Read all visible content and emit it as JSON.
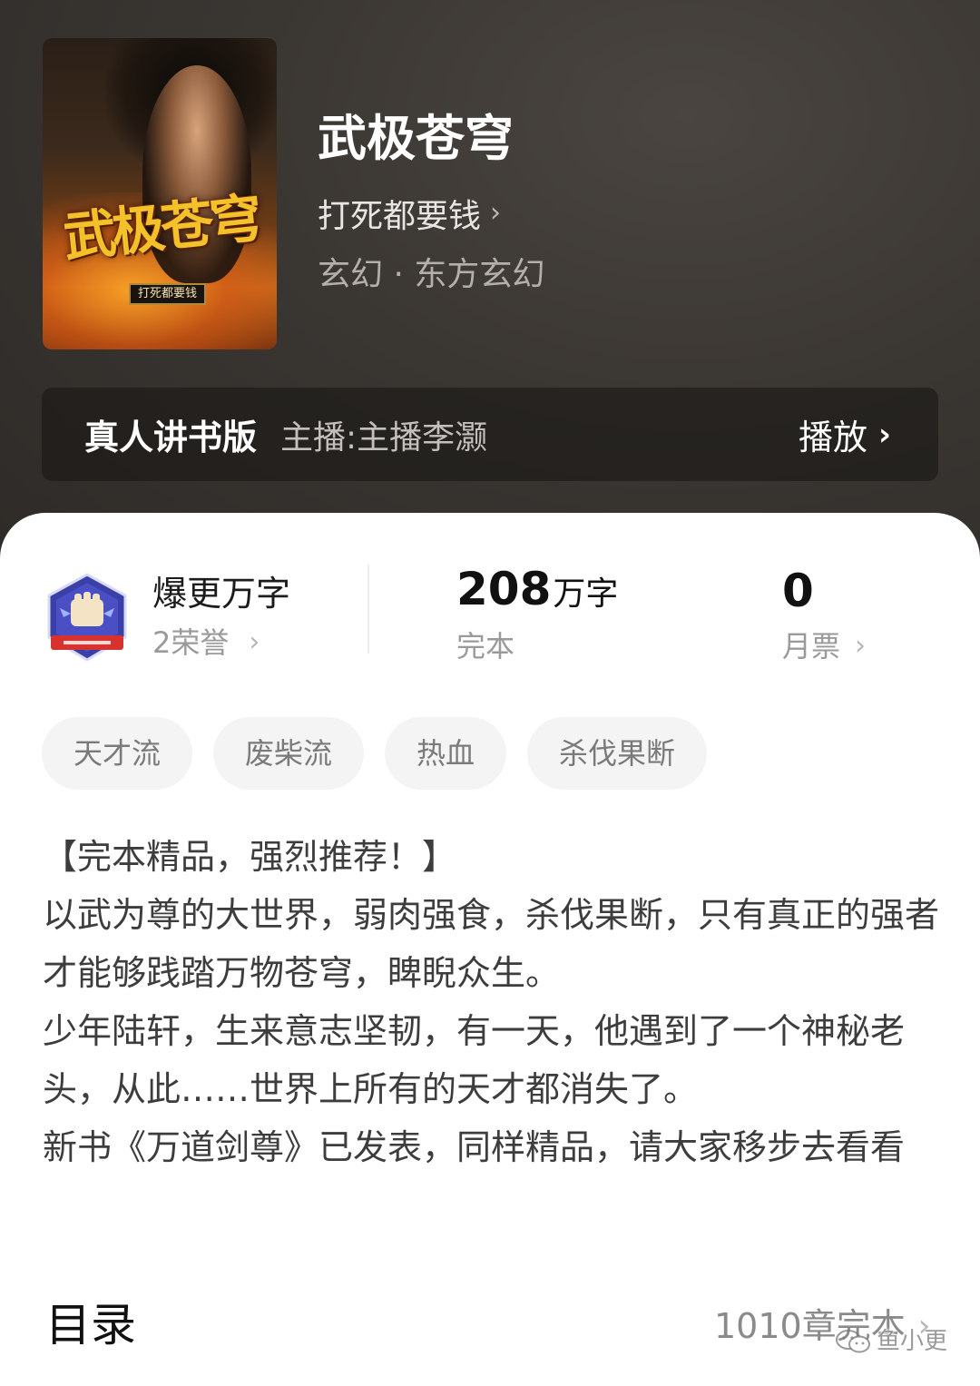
{
  "book": {
    "cover_title": "武极苍穹",
    "cover_author": "打死都要钱",
    "title": "武极苍穹",
    "author": "打死都要钱",
    "genre": "玄幻 · 东方玄幻"
  },
  "audio": {
    "title": "真人讲书版",
    "host": "主播:主播李灏",
    "play_label": "播放"
  },
  "stats": {
    "honor_name": "爆更万字",
    "honor_count": "2荣誉",
    "word_count_num": "208",
    "word_count_unit": "万字",
    "status": "完本",
    "monthly_votes": "0",
    "monthly_label": "月票"
  },
  "tags": [
    "天才流",
    "废柴流",
    "热血",
    "杀伐果断"
  ],
  "synopsis": [
    "【完本精品，强烈推荐！】",
    "以武为尊的大世界，弱肉强食，杀伐果断，只有真正的强者才能够践踏万物苍穹，睥睨众生。",
    "少年陆轩，生来意志坚韧，有一天，他遇到了一个神秘老头，从此……世界上所有的天才都消失了。",
    "新书《万道剑尊》已发表，同样精品，请大家移步去看看"
  ],
  "toc": {
    "title": "目录",
    "count": "1010章完本"
  },
  "watermark": "鱼小更",
  "colors": {
    "header_bg": "#3a3632",
    "tag_bg": "#f4f4f4",
    "badge_blue": "#3b3fa8"
  }
}
